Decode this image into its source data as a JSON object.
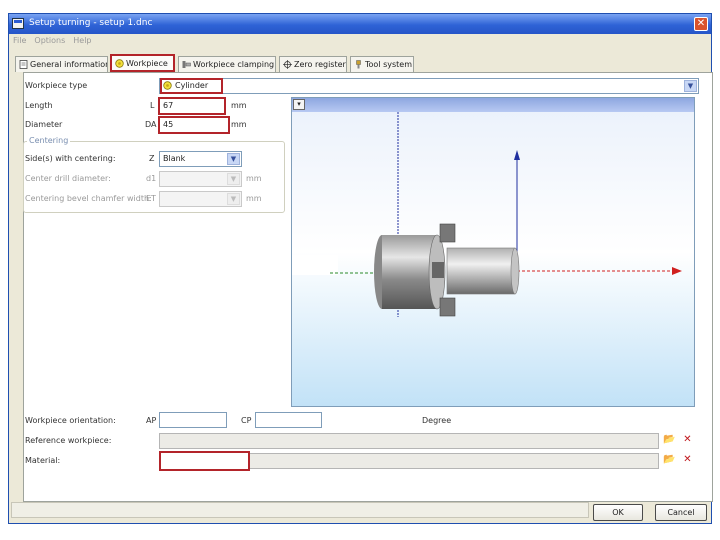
{
  "window": {
    "title": "Setup turning - setup 1.dnc",
    "close_glyph": "✕"
  },
  "menu": [
    "File",
    "Options",
    "Help"
  ],
  "tabs": [
    {
      "label": "General information",
      "icon": "info-icon"
    },
    {
      "label": "Workpiece",
      "icon": "workpiece-icon"
    },
    {
      "label": "Workpiece clamping",
      "icon": "clamping-icon"
    },
    {
      "label": "Zero register",
      "icon": "zero-register-icon"
    },
    {
      "label": "Tool system",
      "icon": "tool-system-icon"
    }
  ],
  "workpiece": {
    "type_label": "Workpiece type",
    "type_value": "Cylinder",
    "length_label": "Length",
    "length_symbol": "L",
    "length_value": "67",
    "length_unit": "mm",
    "diameter_label": "Diameter",
    "diameter_symbol": "DA",
    "diameter_value": "45",
    "diameter_unit": "mm"
  },
  "centering": {
    "group_title": "Centering",
    "sides_label": "Side(s) with centering:",
    "sides_symbol": "Z",
    "sides_value": "Blank",
    "drill_label": "Center drill diameter:",
    "drill_symbol": "d1",
    "drill_unit": "mm",
    "bevel_label": "Centering bevel chamfer width:",
    "bevel_symbol": "ET",
    "bevel_unit": "mm"
  },
  "orientation": {
    "label": "Workpiece orientation:",
    "ap_label": "AP",
    "cp_label": "CP",
    "unit": "Degree"
  },
  "reference": {
    "label": "Reference workpiece:"
  },
  "material": {
    "label": "Material:"
  },
  "buttons": {
    "ok": "OK",
    "cancel": "Cancel",
    "open_glyph": "📂",
    "clear_glyph": "✕"
  },
  "view": {
    "menu_glyph": "▾"
  },
  "colors": {
    "accent_red": "#b3242a",
    "title_blue": "#2f63d6",
    "axis_green": "#2a8a2a",
    "axis_red": "#d02020",
    "axis_blue": "#2030a0"
  }
}
